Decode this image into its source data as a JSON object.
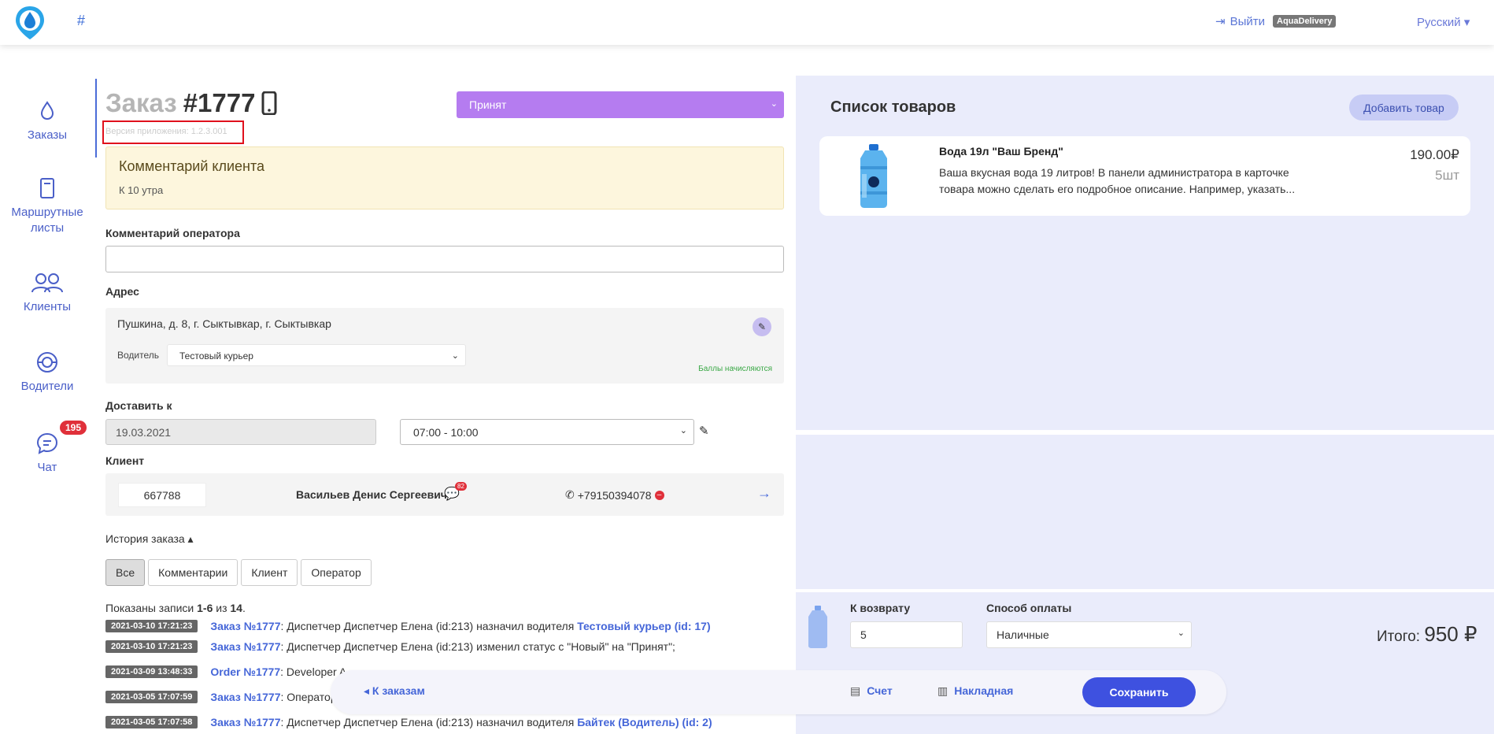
{
  "topbar": {
    "hash": "#",
    "logout_label": "Выйти",
    "brand": "AquaDelivery",
    "language": "Русский"
  },
  "nav": {
    "items": [
      {
        "label": "Заказы",
        "icon": "drop-icon"
      },
      {
        "label": "Маршрутные листы",
        "icon": "document-icon"
      },
      {
        "label": "Клиенты",
        "icon": "users-icon"
      },
      {
        "label": "Водители",
        "icon": "steering-wheel-icon"
      },
      {
        "label": "Чат",
        "icon": "chat-icon",
        "badge": "195"
      }
    ],
    "active_color": "#4b6cd8"
  },
  "order": {
    "title_word": "Заказ",
    "number": "#1777",
    "app_version": "Версия приложения: 1.2.3.001",
    "status": "Принят",
    "client_comment_title": "Комментарий клиента",
    "client_comment": "К 10 утра",
    "operator_comment_label": "Комментарий оператора",
    "operator_comment_value": "",
    "address_label": "Адрес",
    "address": "Пушкина, д. 8, г. Сыктывкар, г. Сыктывкар",
    "driver_label": "Водитель",
    "driver": "Тестовый курьер",
    "points_note": "Баллы начисляются",
    "deliver_label": "Доставить к",
    "date": "19.03.2021",
    "time_slot": "07:00 - 10:00",
    "client_label": "Клиент",
    "client_id": "667788",
    "client_name": "Васильев Денис Сергеевич",
    "client_chat_count": "82",
    "client_phone": "+79150394078"
  },
  "history": {
    "toggle_label": "История заказа",
    "tabs": [
      "Все",
      "Комментарии",
      "Клиент",
      "Оператор"
    ],
    "records_prefix": "Показаны записи",
    "records_range": "1-6",
    "records_of": "из",
    "records_total": "14",
    "rows": [
      {
        "time": "2021-03-10 17:21:23",
        "order": "Заказ №1777",
        "text": ": Диспетчер Диспетчер Елена (id:213) назначил водителя",
        "link": "Тестовый курьер (id: 17)"
      },
      {
        "time": "2021-03-10 17:21:23",
        "order": "Заказ №1777",
        "text": ": Диспетчер Диспетчер Елена (id:213) изменил статус с \"Новый\" на \"Принят\";",
        "link": ""
      },
      {
        "time": "2021-03-09 13:48:33",
        "order": "Order №1777",
        "text": ": Developer A",
        "link": ""
      },
      {
        "time": "2021-03-05 17:07:59",
        "order": "Заказ №1777",
        "text": ": Оператор",
        "link": ""
      },
      {
        "time": "2021-03-05 17:07:58",
        "order": "Заказ №1777",
        "text": ": Диспетчер Диспетчер Елена (id:213) назначил водителя",
        "link": "Байтек (Водитель) (id: 2)"
      }
    ]
  },
  "products": {
    "title": "Список товаров",
    "add_button": "Добавить товар",
    "items": [
      {
        "name": "Вода 19л \"Ваш Бренд\"",
        "description": "Ваша вкусная вода 19 литров! В панели администратора в карточке товара можно сделать его подробное описание. Например, указать...",
        "price": "190.00₽",
        "qty": "5шт"
      }
    ]
  },
  "checkout": {
    "return_label": "К возврату",
    "return_value": "5",
    "payment_label": "Способ оплаты",
    "payment_value": "Наличные",
    "total_label": "Итого:",
    "total_amount": "950 ₽"
  },
  "actions": {
    "back": "К заказам",
    "invoice": "Счет",
    "waybill": "Накладная",
    "save": "Сохранить"
  },
  "colors": {
    "accent": "#3e51e0",
    "status_bg": "#b57cf0",
    "panel_bg": "#eaecfb",
    "link": "#4566d8"
  }
}
